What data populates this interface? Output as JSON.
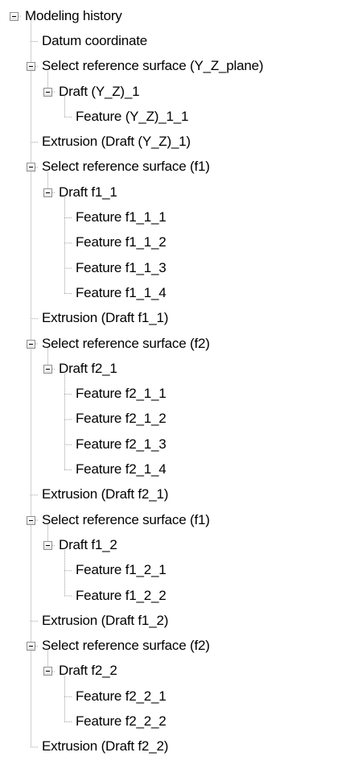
{
  "tree": {
    "root": {
      "label": "Modeling history",
      "expanded": true,
      "children": [
        {
          "label": "Datum coordinate"
        },
        {
          "label": "Select reference surface (Y_Z_plane)",
          "expanded": true,
          "children": [
            {
              "label": "Draft (Y_Z)_1",
              "expanded": true,
              "children": [
                {
                  "label": "Feature (Y_Z)_1_1"
                }
              ]
            }
          ]
        },
        {
          "label": "Extrusion (Draft (Y_Z)_1)"
        },
        {
          "label": "Select reference surface (f1)",
          "expanded": true,
          "children": [
            {
              "label": "Draft f1_1",
              "expanded": true,
              "children": [
                {
                  "label": "Feature f1_1_1"
                },
                {
                  "label": "Feature f1_1_2"
                },
                {
                  "label": "Feature f1_1_3"
                },
                {
                  "label": "Feature f1_1_4"
                }
              ]
            }
          ]
        },
        {
          "label": "Extrusion (Draft f1_1)"
        },
        {
          "label": "Select reference surface (f2)",
          "expanded": true,
          "children": [
            {
              "label": "Draft f2_1",
              "expanded": true,
              "children": [
                {
                  "label": "Feature f2_1_1"
                },
                {
                  "label": "Feature f2_1_2"
                },
                {
                  "label": "Feature f2_1_3"
                },
                {
                  "label": "Feature f2_1_4"
                }
              ]
            }
          ]
        },
        {
          "label": "Extrusion (Draft f2_1)"
        },
        {
          "label": "Select reference surface (f1)",
          "expanded": true,
          "children": [
            {
              "label": "Draft f1_2",
              "expanded": true,
              "children": [
                {
                  "label": "Feature f1_2_1"
                },
                {
                  "label": "Feature f1_2_2"
                }
              ]
            }
          ]
        },
        {
          "label": "Extrusion (Draft f1_2)"
        },
        {
          "label": "Select reference surface (f2)",
          "expanded": true,
          "children": [
            {
              "label": "Draft f2_2",
              "expanded": true,
              "children": [
                {
                  "label": "Feature f2_2_1"
                },
                {
                  "label": "Feature f2_2_2"
                }
              ]
            }
          ]
        },
        {
          "label": "Extrusion (Draft f2_2)"
        }
      ]
    }
  },
  "colors": {
    "guide_line": "#a0a0a0",
    "toggle_border": "#8f8f8f",
    "text": "#000000",
    "background": "#ffffff"
  }
}
